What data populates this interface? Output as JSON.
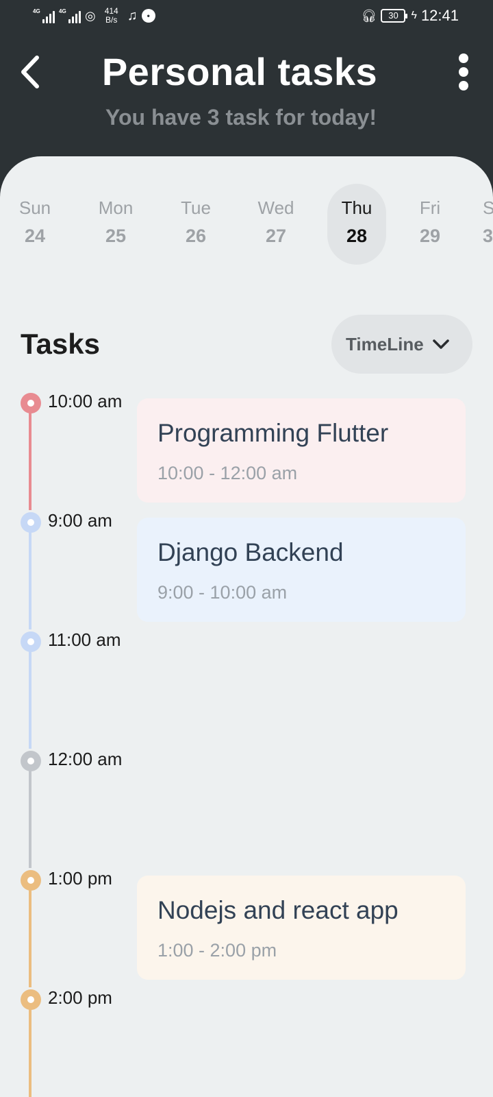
{
  "status_bar": {
    "net1": "4G",
    "net2": "4G",
    "speed_value": "414",
    "speed_unit": "B/s",
    "battery": "30",
    "time": "12:41",
    "icons": [
      "signal-icon",
      "hotspot-icon",
      "music-icon",
      "notification-icon",
      "headset-icon",
      "battery-icon",
      "charging-icon"
    ]
  },
  "header": {
    "title": "Personal tasks",
    "subtitle": "You have 3 task for today!",
    "back_icon": "back-arrow-icon",
    "menu_icon": "more-vertical-icon"
  },
  "calendar": {
    "days": [
      {
        "name": "Sun",
        "date": "24"
      },
      {
        "name": "Mon",
        "date": "25"
      },
      {
        "name": "Tue",
        "date": "26"
      },
      {
        "name": "Wed",
        "date": "27"
      },
      {
        "name": "Thu",
        "date": "28"
      },
      {
        "name": "Fri",
        "date": "29"
      },
      {
        "name": "S",
        "date": "3"
      }
    ],
    "selected": "Thu"
  },
  "tasks": {
    "heading": "Tasks",
    "view_mode": "TimeLine",
    "timeline": [
      {
        "time": "10:00 am",
        "color": "#e88b91",
        "task": {
          "title": "Programming Flutter",
          "range": "10:00 - 12:00 am",
          "bg": "#fbeff0"
        }
      },
      {
        "time": "9:00 am",
        "color": "#c6d8f6",
        "task": {
          "title": "Django Backend",
          "range": "9:00 - 10:00 am",
          "bg": "#eaf2fc"
        }
      },
      {
        "time": "11:00 am",
        "color": "#c6d8f6"
      },
      {
        "time": "12:00 am",
        "color": "#c2c6cb"
      },
      {
        "time": "1:00 pm",
        "color": "#ebbd80",
        "task": {
          "title": "Nodejs and react app",
          "range": "1:00 - 2:00 pm",
          "bg": "#fcf5ec"
        }
      },
      {
        "time": "2:00 pm",
        "color": "#ebbd80"
      }
    ]
  }
}
